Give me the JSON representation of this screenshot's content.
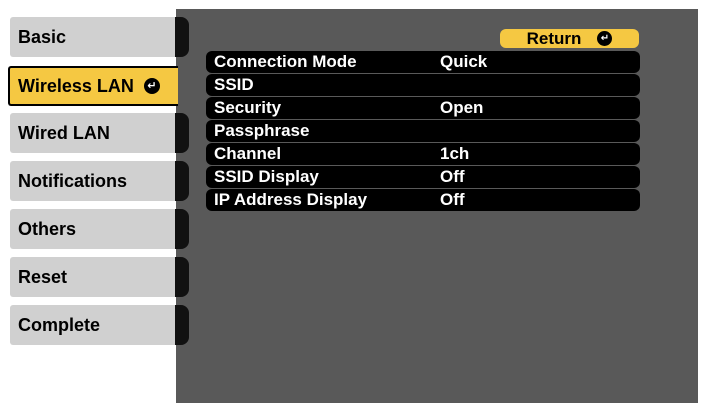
{
  "sidebar": {
    "tabs": [
      {
        "label": "Basic"
      },
      {
        "label": "Wireless LAN",
        "selected": true
      },
      {
        "label": "Wired LAN"
      },
      {
        "label": "Notifications"
      },
      {
        "label": "Others"
      },
      {
        "label": "Reset"
      },
      {
        "label": "Complete"
      }
    ]
  },
  "header": {
    "return_label": "Return"
  },
  "settings": [
    {
      "label": "Connection Mode",
      "value": "Quick"
    },
    {
      "label": "SSID",
      "value": ""
    },
    {
      "label": "Security",
      "value": "Open"
    },
    {
      "label": "Passphrase",
      "value": ""
    },
    {
      "label": "Channel",
      "value": "1ch"
    },
    {
      "label": "SSID Display",
      "value": "Off"
    },
    {
      "label": "IP Address Display",
      "value": "Off"
    }
  ],
  "icons": {
    "enter": "enter-icon"
  },
  "colors": {
    "accent": "#f5c842",
    "panel": "#595959",
    "tab": "#d0d0d0",
    "row": "#000000"
  }
}
